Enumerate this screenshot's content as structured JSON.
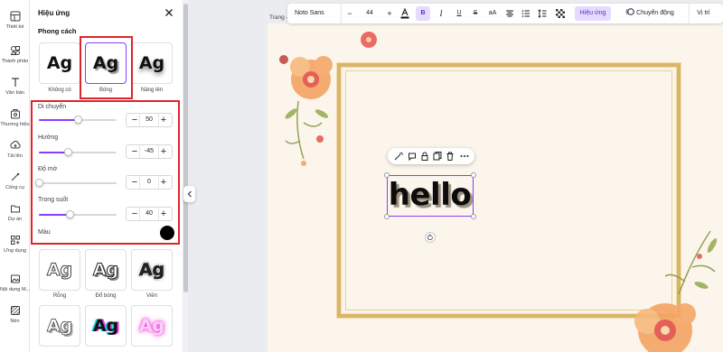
{
  "rail": {
    "items": [
      {
        "label": "Thiết kế",
        "icon": "layout-icon"
      },
      {
        "label": "Thành phần",
        "icon": "elements-icon"
      },
      {
        "label": "Văn bản",
        "icon": "text-icon"
      },
      {
        "label": "Thương hiệu",
        "icon": "brand-icon"
      },
      {
        "label": "Tải lên",
        "icon": "upload-icon"
      },
      {
        "label": "Công cụ",
        "icon": "tools-icon"
      },
      {
        "label": "Dự án",
        "icon": "folder-icon"
      },
      {
        "label": "Ứng dụng",
        "icon": "apps-icon"
      },
      {
        "label": "Nội dung M...",
        "icon": "media-icon"
      },
      {
        "label": "Nền",
        "icon": "background-icon"
      }
    ]
  },
  "panel": {
    "title": "Hiệu ứng",
    "style_heading": "Phong cách",
    "styles_top": [
      {
        "label": "Không có",
        "sample": "Ag"
      },
      {
        "label": "Bóng",
        "sample": "Ag"
      },
      {
        "label": "Nâng lên",
        "sample": "Ag"
      }
    ],
    "controls": [
      {
        "label": "Di chuyển",
        "value": "50",
        "fraction": 0.5
      },
      {
        "label": "Hướng",
        "value": "-45",
        "fraction": 0.375
      },
      {
        "label": "Độ mờ",
        "value": "0",
        "fraction": 0.0
      },
      {
        "label": "Trong suốt",
        "value": "40",
        "fraction": 0.4
      }
    ],
    "color_label": "Màu",
    "color_value": "#000000",
    "styles_more": [
      {
        "label": "Rỗng",
        "sample": "Ag"
      },
      {
        "label": "Đổ bóng",
        "sample": "Ag"
      },
      {
        "label": "Viền",
        "sample": "Ag"
      },
      {
        "label": "",
        "sample": "Ag"
      },
      {
        "label": "",
        "sample": "Ag"
      },
      {
        "label": "",
        "sample": "Ag"
      }
    ]
  },
  "toolbar": {
    "font": "Noto Sans",
    "font_size": "44",
    "minus": "−",
    "plus": "+",
    "case": "aA",
    "effects": "Hiệu ứng",
    "animate": "Chuyển động",
    "position": "Vị trí"
  },
  "page_label": "Trang -",
  "canvas": {
    "text": "hello"
  },
  "colors": {
    "accent": "#8b3dff",
    "highlight": "#e0242b",
    "frame": "#d8b56a"
  }
}
